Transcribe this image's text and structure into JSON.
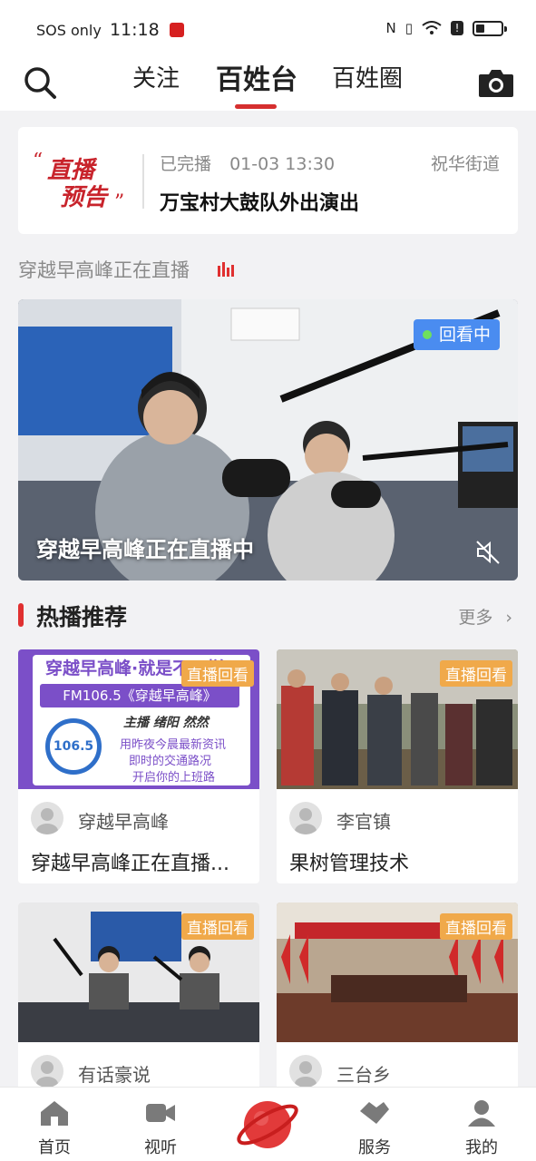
{
  "status_bar": {
    "carrier": "SOS only",
    "time": "11:18"
  },
  "top_nav": {
    "tabs": [
      {
        "label": "关注"
      },
      {
        "label": "百姓台"
      },
      {
        "label": "百姓圈"
      }
    ],
    "active_tab": "百姓台"
  },
  "live_notice": {
    "logo_line1": "直播",
    "logo_line2": "预告",
    "status": "已完播",
    "datetime": "01-03 13:30",
    "location": "祝华街道",
    "title": "万宝村大鼓队外出演出"
  },
  "live_section": {
    "label": "穿越早高峰正在直播"
  },
  "main_video": {
    "badge": "回看中",
    "caption": "穿越早高峰正在直播中"
  },
  "recommend": {
    "title": "热播推荐",
    "more_label": "更多",
    "cards": [
      {
        "tag": "直播回看",
        "author": "穿越早高峰",
        "title": "穿越早高峰正在直播...",
        "thumb_text": [
          "穿越早高峰·就是不一样",
          "FM106.5《穿越早高峰》",
          "主播 绪阳 然然",
          "用昨夜今晨最新资讯",
          "即时的交通路况",
          "开启你的上班路"
        ]
      },
      {
        "tag": "直播回看",
        "author": "李官镇",
        "title": "果树管理技术"
      },
      {
        "tag": "直播回看",
        "author": "有话豪说",
        "title": ""
      },
      {
        "tag": "直播回看",
        "author": "三台乡",
        "title": ""
      }
    ]
  },
  "bottom_nav": {
    "items": [
      {
        "label": "首页"
      },
      {
        "label": "视听"
      },
      {
        "label": "服务"
      },
      {
        "label": "我的"
      }
    ]
  },
  "colors": {
    "accent": "#d62f2f",
    "badge_blue": "#4a8cf0",
    "tag_orange": "#f0a94a"
  }
}
